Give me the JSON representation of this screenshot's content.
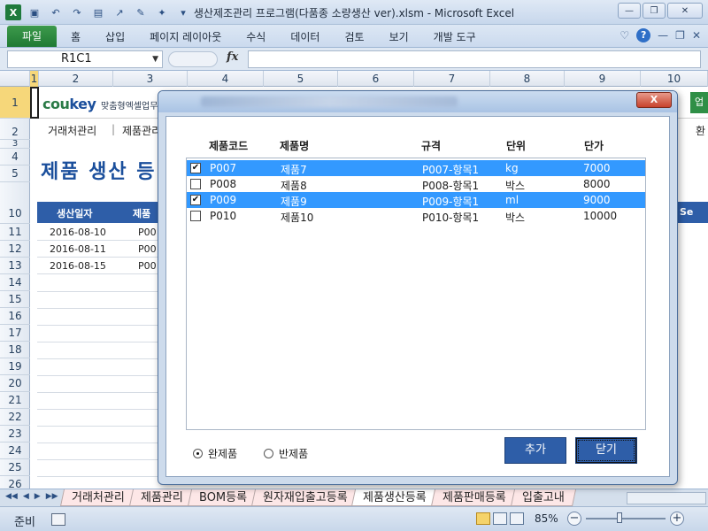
{
  "window": {
    "title": "생산제조관리 프로그램(다품종 소량생산 ver).xlsm  -  Microsoft Excel"
  },
  "ribbon": {
    "file_tab": "파일",
    "tabs": [
      "홈",
      "삽입",
      "페이지 레이아웃",
      "수식",
      "데이터",
      "검토",
      "보기",
      "개발 도구"
    ]
  },
  "formula_bar": {
    "name_box": "R1C1",
    "fx_label": "fx",
    "formula_value": ""
  },
  "columns": [
    "1",
    "2",
    "3",
    "4",
    "5",
    "6",
    "7",
    "8",
    "9",
    "10"
  ],
  "rows": [
    "1",
    "2",
    "3",
    "4",
    "5",
    "10",
    "11",
    "12",
    "13",
    "14",
    "15",
    "16",
    "17",
    "18",
    "19",
    "20",
    "21",
    "22",
    "23",
    "24",
    "25",
    "26"
  ],
  "sheet_content": {
    "logo_main": "cou",
    "logo_accent": "key",
    "logo_sub": "맞춤형엑셀업무자",
    "green_tab": "업",
    "nav": [
      "거래처관리",
      "제품관리"
    ],
    "right_nav": "환",
    "page_title": "제품 생산 등",
    "table_headers": [
      "생산일자",
      "제품코"
    ],
    "table_right_header": "Se",
    "data_rows": [
      {
        "date": "2016-08-10",
        "code": "P00"
      },
      {
        "date": "2016-08-11",
        "code": "P00"
      },
      {
        "date": "2016-08-15",
        "code": "P00"
      }
    ]
  },
  "dialog": {
    "close_label": "X",
    "headers": {
      "code": "제품코드",
      "name": "제품명",
      "spec": "규격",
      "unit": "단위",
      "price": "단가"
    },
    "items": [
      {
        "checked": true,
        "selected": true,
        "code": "P007",
        "name": "제품7",
        "spec": "P007-항목1",
        "unit": "kg",
        "price": "7000"
      },
      {
        "checked": false,
        "selected": false,
        "code": "P008",
        "name": "제품8",
        "spec": "P008-항목1",
        "unit": "박스",
        "price": "8000"
      },
      {
        "checked": true,
        "selected": true,
        "code": "P009",
        "name": "제품9",
        "spec": "P009-항목1",
        "unit": "ml",
        "price": "9000"
      },
      {
        "checked": false,
        "selected": false,
        "code": "P010",
        "name": "제품10",
        "spec": "P010-항목1",
        "unit": "박스",
        "price": "10000"
      }
    ],
    "radio_options": [
      {
        "label": "완제품",
        "selected": true
      },
      {
        "label": "반제품",
        "selected": false
      }
    ],
    "add_button": "추가",
    "close_button": "닫기"
  },
  "sheet_tabs": [
    "거래처관리",
    "제품관리",
    "BOM등록",
    "원자재입출고등록",
    "제품생산등록",
    "제품판매등록",
    "입출고내"
  ],
  "active_sheet_tab": "제품생산등록",
  "status": {
    "ready_text": "준비",
    "zoom": "85%",
    "zoom_minus": "−",
    "zoom_plus": "+"
  },
  "colors": {
    "accent_blue": "#2e5ea8",
    "selection": "#3399ff",
    "file_tab_green": "#1f7a34"
  }
}
